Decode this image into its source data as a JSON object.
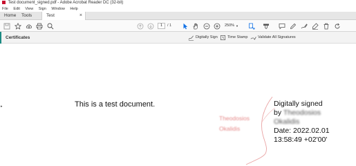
{
  "window": {
    "title": "Test document_signed.pdf - Adobe Acrobat Reader DC (32-bit)"
  },
  "menu": [
    "File",
    "Edit",
    "View",
    "Sign",
    "Window",
    "Help"
  ],
  "tabs": {
    "home": "Home",
    "tools": "Tools",
    "doc": "Test document_sig..."
  },
  "toolbar": {
    "page_current": "1",
    "page_total": "/ 1",
    "zoom": "250%"
  },
  "signature_bar": {
    "label": "Certificates",
    "digitally_sign": "Digitally Sign",
    "time_stamp": "Time Stamp",
    "validate_all": "Validate All Signatures"
  },
  "document": {
    "body_text": "This is a test document.",
    "signature_name_first": "Theodosios",
    "signature_name_last": "Okalidis",
    "sig_line1": "Digitally signed",
    "sig_line2_prefix": "by",
    "sig_line2_name": "Theodosios",
    "sig_line3_name": "Okalidis",
    "sig_line4": "Date: 2022.02.01",
    "sig_line5": "13:58:49 +02'00'"
  },
  "colors": {
    "accent": "#1b8a83",
    "toolbar_icon": "#555555",
    "cursor_blue": "#1473e6",
    "signature_red": "#e58a8a"
  }
}
